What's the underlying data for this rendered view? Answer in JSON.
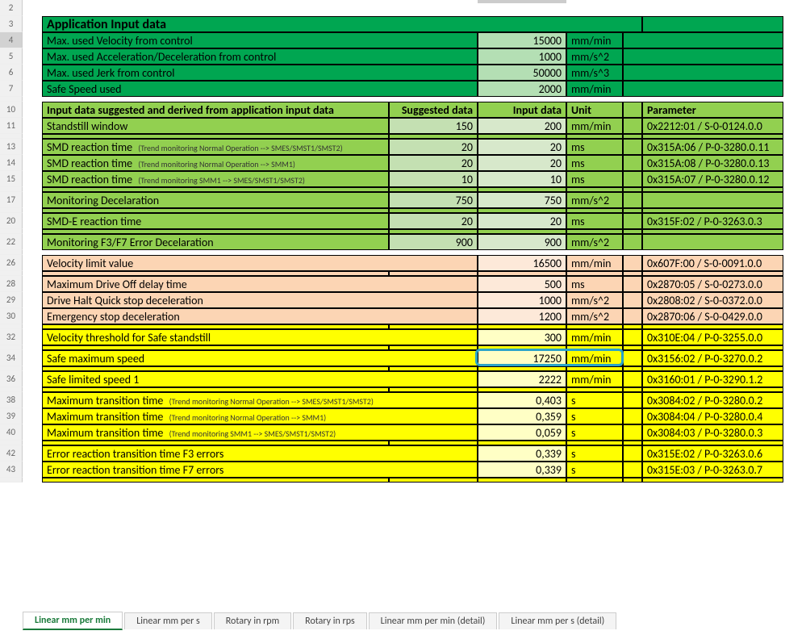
{
  "rowNumbers": [
    "2",
    "3",
    "4",
    "5",
    "6",
    "7",
    "",
    "10",
    "11",
    "",
    "13",
    "14",
    "15",
    "",
    "17",
    "",
    "20",
    "",
    "22",
    "",
    "26",
    "",
    "28",
    "29",
    "30",
    "",
    "32",
    "",
    "34",
    "",
    "36",
    "",
    "38",
    "39",
    "40",
    "",
    "42",
    "43",
    ""
  ],
  "greenTitle": "Application Input data",
  "greenRows": [
    {
      "label": "Max. used Velocity from control",
      "value": "15000",
      "unit": "mm/min"
    },
    {
      "label": "Max. used Acceleration/Deceleration from control",
      "value": "1000",
      "unit": "mm/s^2"
    },
    {
      "label": "Max. used Jerk from control",
      "value": "50000",
      "unit": "mm/s^3"
    },
    {
      "label": "Safe Speed used",
      "value": "2000",
      "unit": "mm/min"
    }
  ],
  "section2": {
    "header": {
      "label": "Input data suggested and derived from application input data",
      "suggested": "Suggested data",
      "input": "Input data",
      "unit": "Unit",
      "param": "Parameter"
    },
    "rows": [
      {
        "label": "Standstill window",
        "subnote": "",
        "suggested": "150",
        "input": "200",
        "unit": "mm/min",
        "param": "0x2212:01 / S-0-0124.0.0"
      },
      null,
      {
        "label": "SMD reaction time",
        "subnote": "(Trend monitoring Normal Operation --> SMES/SMST1/SMST2)",
        "suggested": "20",
        "input": "20",
        "unit": "ms",
        "param": "0x315A:06 / P-0-3280.0.11"
      },
      {
        "label": "SMD reaction time",
        "subnote": "(Trend monitoring Normal Operation --> SMM1)",
        "suggested": "20",
        "input": "20",
        "unit": "ms",
        "param": "0x315A:08 / P-0-3280.0.13"
      },
      {
        "label": "SMD reaction time",
        "subnote": "(Trend monitoring SMM1 --> SMES/SMST1/SMST2)",
        "suggested": "10",
        "input": "10",
        "unit": "ms",
        "param": "0x315A:07 / P-0-3280.0.12"
      },
      null,
      {
        "label": "Monitoring Decelaration",
        "subnote": "",
        "suggested": "750",
        "input": "750",
        "unit": "mm/s^2",
        "param": ""
      },
      null,
      {
        "label": "SMD-E reaction time",
        "subnote": "",
        "suggested": "20",
        "input": "20",
        "unit": "ms",
        "param": "0x315F:02 / P-0-3263.0.3"
      },
      null,
      {
        "label": "Monitoring F3/F7 Error Decelaration",
        "subnote": "",
        "suggested": "900",
        "input": "900",
        "unit": "mm/s^2",
        "param": ""
      }
    ]
  },
  "orange": [
    {
      "label": "Velocity limit value",
      "value": "16500",
      "unit": "mm/min",
      "param": "0x607F:00 / S-0-0091.0.0"
    },
    null,
    {
      "label": "Maximum Drive Off delay time",
      "value": "500",
      "unit": "ms",
      "param": "0x2870:05 / S-0-0273.0.0"
    },
    {
      "label": "Drive Halt Quick stop deceleration",
      "value": "1000",
      "unit": "mm/s^2",
      "param": "0x2808:02 / S-0-0372.0.0"
    },
    {
      "label": "Emergency stop deceleration",
      "value": "1200",
      "unit": "mm/s^2",
      "param": "0x2870:06 / S-0-0429.0.0"
    }
  ],
  "yellow": [
    {
      "label": "Velocity threshold for Safe standstill",
      "subnote": "",
      "value": "300",
      "unit": "mm/min",
      "param": "0x310E:04 / P-0-3255.0.0"
    },
    null,
    {
      "label": "Safe maximum speed",
      "subnote": "",
      "value": "17250",
      "unit": "mm/min",
      "param": "0x3156:02 / P-0-3270.0.2",
      "highlight": true
    },
    null,
    {
      "label": "Safe limited speed 1",
      "subnote": "",
      "value": "2222",
      "unit": "mm/min",
      "param": "0x3160:01 / P-0-3290.1.2"
    },
    null,
    {
      "label": "Maximum transition time",
      "subnote": "(Trend monitoring Normal Operation --> SMES/SMST1/SMST2)",
      "value": "0,403",
      "unit": "s",
      "param": "0x3084:02 / P-0-3280.0.2"
    },
    {
      "label": "Maximum transition time",
      "subnote": "(Trend monitoring Normal Operation --> SMM1)",
      "value": "0,359",
      "unit": "s",
      "param": "0x3084:04 / P-0-3280.0.4"
    },
    {
      "label": "Maximum transition time",
      "subnote": "(Trend monitoring SMM1 --> SMES/SMST1/SMST2)",
      "value": "0,059",
      "unit": "s",
      "param": "0x3084:03 / P-0-3280.0.3"
    },
    null,
    {
      "label": "Error reaction transition time F3 errors",
      "subnote": "",
      "value": "0,339",
      "unit": "s",
      "param": "0x315E:02 / P-0-3263.0.6"
    },
    {
      "label": "Error reaction transition time F7 errors",
      "subnote": "",
      "value": "0,339",
      "unit": "s",
      "param": "0x315E:03 / P-0-3263.0.7"
    }
  ],
  "tabs": [
    "Linear mm per min",
    "Linear mm per s",
    "Rotary in rpm",
    "Rotary in rps",
    "Linear mm per min (detail)",
    "Linear mm per s (detail)"
  ],
  "activeTab": 0
}
